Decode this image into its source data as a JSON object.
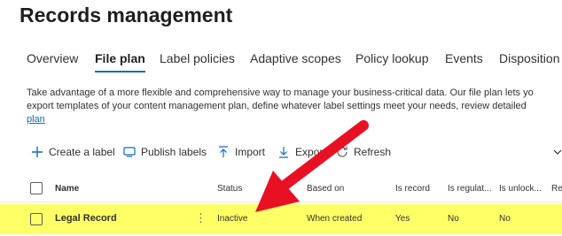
{
  "page": {
    "title": "Records management"
  },
  "tabs": [
    {
      "label": "Overview",
      "active": false
    },
    {
      "label": "File plan",
      "active": true
    },
    {
      "label": "Label policies",
      "active": false
    },
    {
      "label": "Adaptive scopes",
      "active": false
    },
    {
      "label": "Policy lookup",
      "active": false
    },
    {
      "label": "Events",
      "active": false
    },
    {
      "label": "Disposition",
      "active": false
    }
  ],
  "description": {
    "line1": "Take advantage of a more flexible and comprehensive way to manage your business-critical data. Our file plan lets yo",
    "line2": "export templates of your content management plan, define whatever label settings meet your needs, review detailed",
    "link": "plan"
  },
  "toolbar": {
    "create_label": "Create a label",
    "publish_labels": "Publish labels",
    "import": "Import",
    "export": "Export",
    "refresh": "Refresh"
  },
  "table": {
    "columns": [
      "Name",
      "Status",
      "Based on",
      "Is record",
      "Is regulat...",
      "Is unlock...",
      "Re"
    ],
    "rows": [
      {
        "name": "Legal Record",
        "more": "⋮",
        "status": "Inactive",
        "based_on": "When created",
        "is_record": "Yes",
        "is_regulatory": "No",
        "is_unlocked": "No"
      }
    ]
  },
  "colors": {
    "accent": "#0f6cbd",
    "highlight": "#ffff66",
    "annotation_arrow": "#e81123"
  }
}
